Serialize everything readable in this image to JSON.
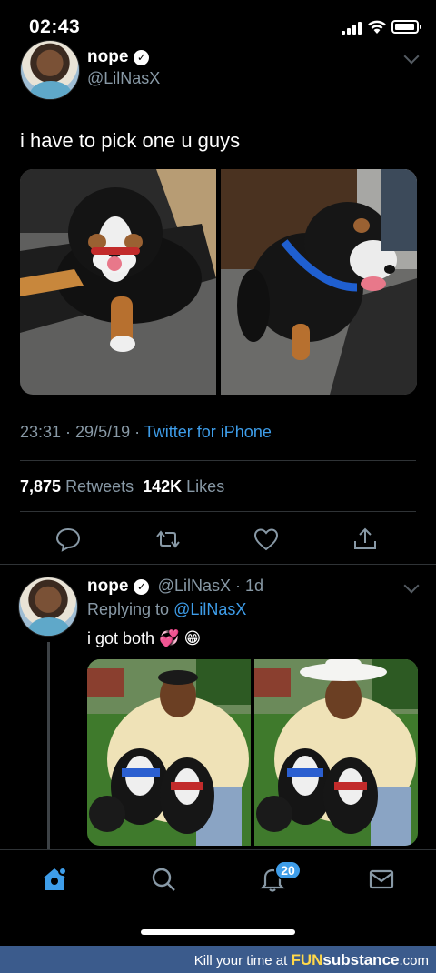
{
  "status_bar": {
    "time": "02:43"
  },
  "tweet": {
    "author_name": "nope",
    "author_handle": "@LilNasX",
    "text": "i have to pick one u guys",
    "timestamp": "23:31 · 29/5/19 · ",
    "source": "Twitter for iPhone",
    "retweet_count": "7,875",
    "retweet_label": "Retweets",
    "like_count": "142K",
    "like_label": "Likes",
    "photos": [
      {
        "subject": "bernese-puppy-red-collar"
      },
      {
        "subject": "bernese-puppy-blue-collar"
      }
    ],
    "actions": [
      "reply-icon",
      "retweet-icon",
      "like-icon",
      "share-icon"
    ]
  },
  "reply": {
    "author_name": "nope",
    "author_handle": "@LilNasX · 1d",
    "replying_prefix": "Replying to ",
    "replying_to": "@LilNasX",
    "text": "i got both ",
    "emojis": "💞 😁",
    "photos": [
      {
        "subject": "man-with-two-puppies-no-hat"
      },
      {
        "subject": "man-with-two-puppies-cowboy-hat"
      }
    ]
  },
  "tab_bar": {
    "items": [
      "home-icon",
      "search-icon",
      "notifications-icon",
      "messages-icon"
    ],
    "active": "home-icon",
    "notifications_badge": "20"
  },
  "watermark": {
    "prefix": "Kill your time at ",
    "brand_fun": "FUN",
    "brand_rest": "substance",
    "brand_tld": ".com"
  },
  "colors": {
    "background": "#000000",
    "accent": "#3e9de9",
    "secondary_text": "#8899a6",
    "divider": "#2f3336",
    "watermark_bar": "#3b5b8c"
  }
}
